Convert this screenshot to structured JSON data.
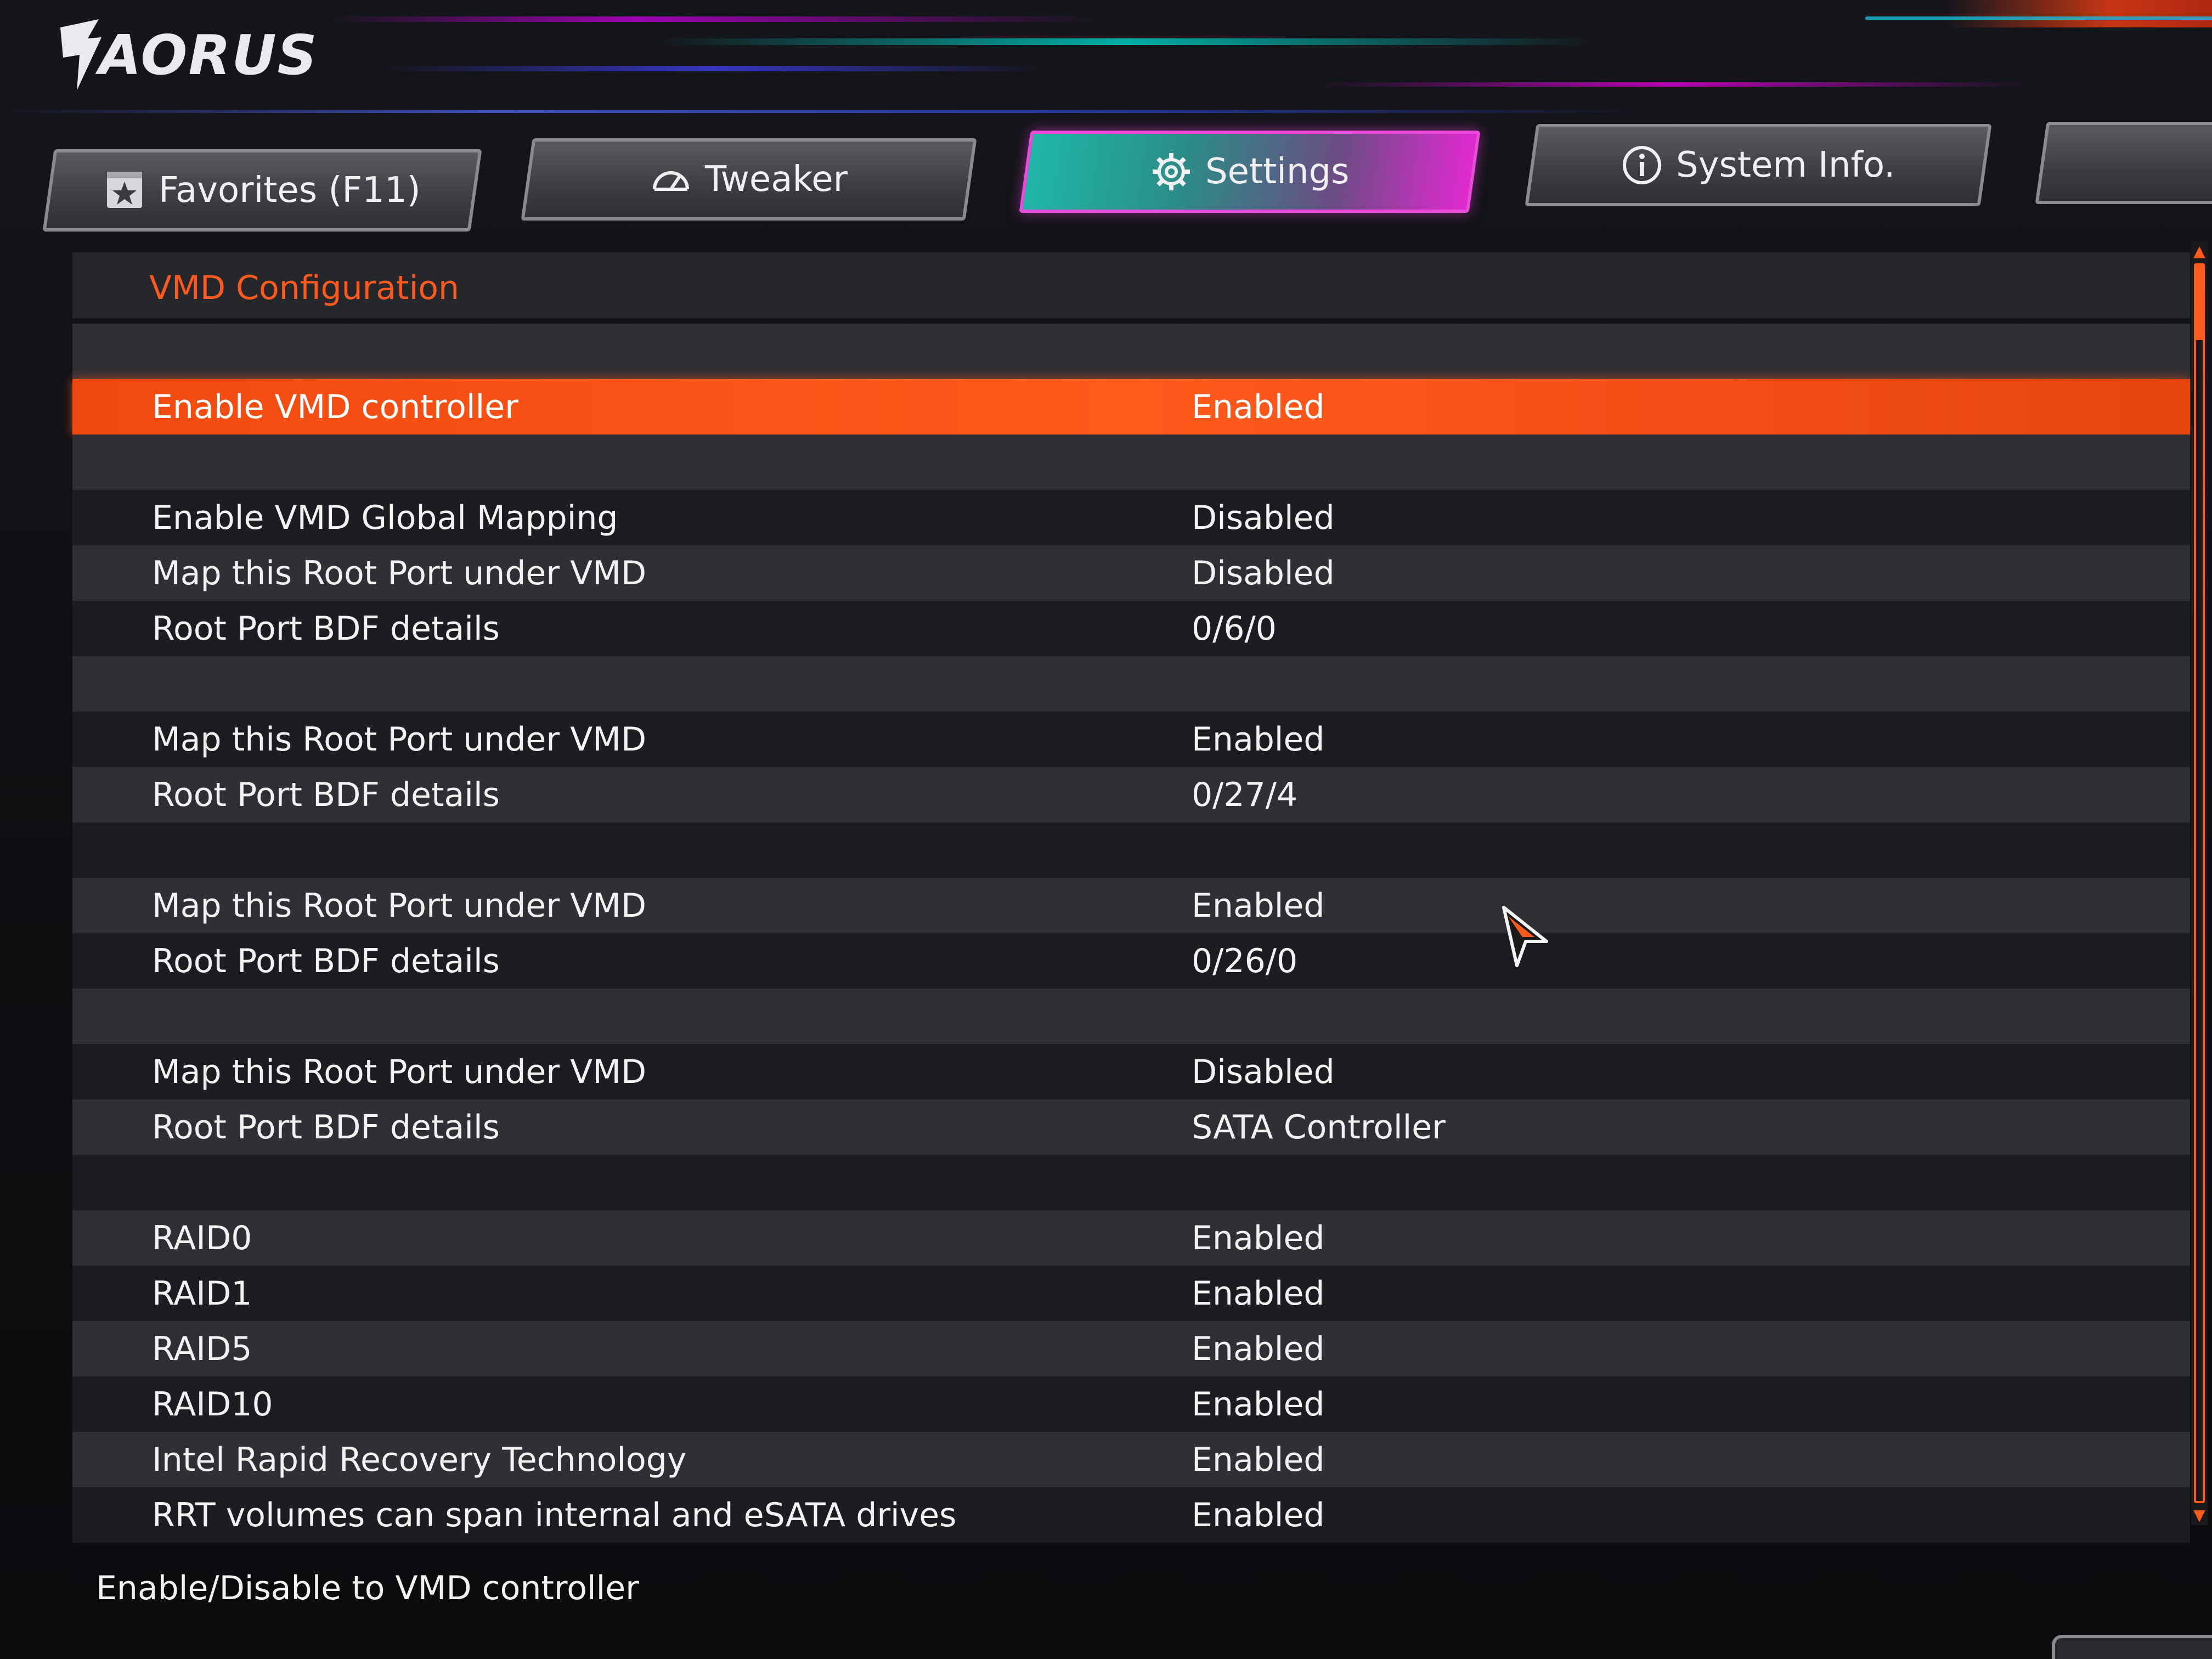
{
  "brand": {
    "logo_text": "AORUS"
  },
  "tabs": [
    {
      "label": "Favorites (F11)",
      "icon": "star-icon"
    },
    {
      "label": "Tweaker",
      "icon": "gauge-icon"
    },
    {
      "label": "Settings",
      "icon": "gear-icon",
      "active": true
    },
    {
      "label": "System Info.",
      "icon": "info-icon"
    },
    {
      "label": "",
      "icon": "partial-tab"
    }
  ],
  "section": {
    "title": "VMD Configuration"
  },
  "rows": [
    {
      "label": "",
      "value": ""
    },
    {
      "label": "Enable VMD controller",
      "value": "Enabled",
      "selected": true
    },
    {
      "label": "",
      "value": ""
    },
    {
      "label": "Enable VMD Global Mapping",
      "value": "Disabled"
    },
    {
      "label": "Map this Root Port under VMD",
      "value": "Disabled"
    },
    {
      "label": "Root Port BDF details",
      "value": "0/6/0"
    },
    {
      "label": "",
      "value": ""
    },
    {
      "label": "Map this Root Port under VMD",
      "value": "Enabled"
    },
    {
      "label": "Root Port BDF details",
      "value": "0/27/4"
    },
    {
      "label": "",
      "value": ""
    },
    {
      "label": "Map this Root Port under VMD",
      "value": "Enabled"
    },
    {
      "label": "Root Port BDF details",
      "value": "0/26/0"
    },
    {
      "label": "",
      "value": ""
    },
    {
      "label": "Map this Root Port under VMD",
      "value": "Disabled"
    },
    {
      "label": "Root Port BDF details",
      "value": "SATA Controller"
    },
    {
      "label": "",
      "value": ""
    },
    {
      "label": "RAID0",
      "value": "Enabled"
    },
    {
      "label": "RAID1",
      "value": "Enabled"
    },
    {
      "label": "RAID5",
      "value": "Enabled"
    },
    {
      "label": "RAID10",
      "value": "Enabled"
    },
    {
      "label": "Intel Rapid Recovery Technology",
      "value": "Enabled"
    },
    {
      "label": "RRT volumes can span internal and eSATA drives",
      "value": "Enabled"
    }
  ],
  "help_text": "Enable/Disable to VMD controller",
  "colors": {
    "accent": "#ff5a1e",
    "tab_active_start": "#1fb7a8",
    "tab_active_end": "#e02ad0"
  }
}
